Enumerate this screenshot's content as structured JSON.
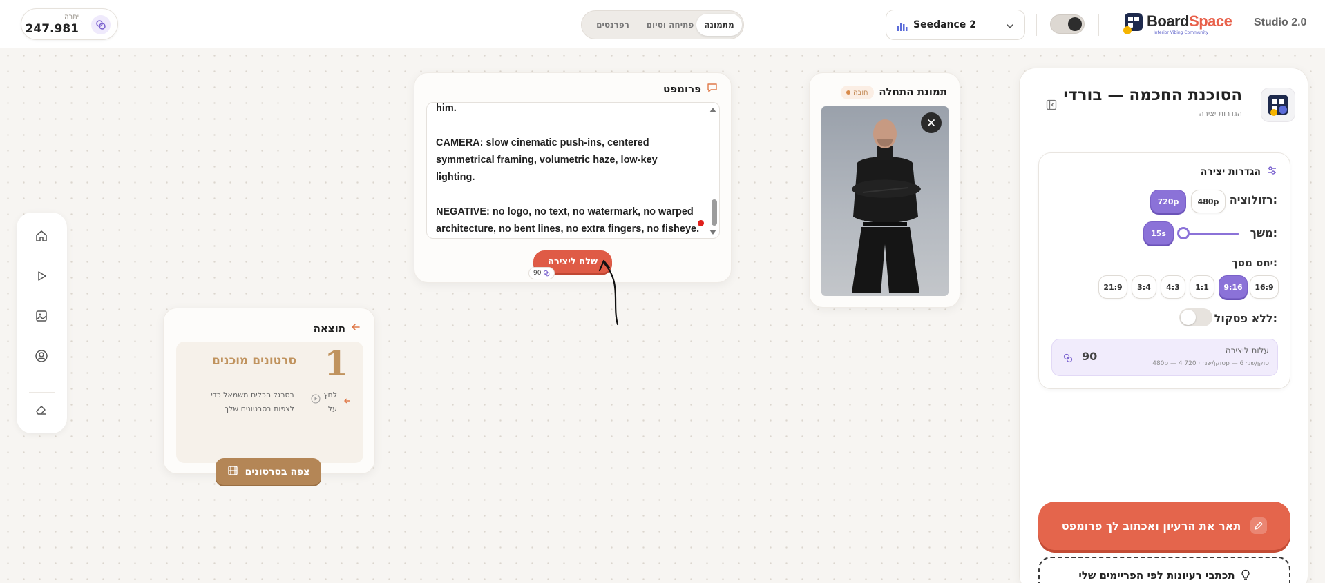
{
  "header": {
    "credits_label": "יתרה",
    "credits_value": "247.981",
    "modes": [
      {
        "label": "מתמונה",
        "active": true
      },
      {
        "label": "פתיחה וסיום",
        "active": false
      },
      {
        "label": "רפרנסים",
        "active": false
      }
    ],
    "model_name": "Seedance 2",
    "brand_name_main": "Board",
    "brand_name_accent": "Space",
    "brand_tagline": "Interior Vibing Community",
    "studio_label": "Studio 2.0"
  },
  "sidebar_tools": [
    "home-icon",
    "play-icon",
    "image-icon",
    "user-icon",
    "eraser-icon"
  ],
  "result_card": {
    "title": "תוצאה",
    "count": "1",
    "ready_label": "סרטונים מוכנים",
    "hint_text": "בסרגל הכלים משמאל כדי לצפות בסרטונים שלך",
    "click_text": "לחץ על",
    "watch_button": "צפה בסרטונים"
  },
  "prompt_card": {
    "title": "פרומפט",
    "text": "him.\n\nCAMERA: slow cinematic push-ins, centered\nsymmetrical framing, volumetric haze, low-key\nlighting.\n\nNEGATIVE: no logo, no text, no watermark, no warped\narchitecture, no bent lines, no extra fingers, no fisheye.",
    "send_button": "שלח ליצירה",
    "send_cost": "90"
  },
  "start_image_card": {
    "title": "תמונת התחלה",
    "required_badge": "חובה"
  },
  "right_panel": {
    "title": "הסוכנת החכמה — בורדי",
    "subtitle": "הגדרות יצירה",
    "settings_title": "הגדרות יצירה",
    "resolution_label": "רזולוציה:",
    "resolution_options": [
      {
        "label": "720p",
        "active": true
      },
      {
        "label": "480p",
        "active": false
      }
    ],
    "duration_label": "משך:",
    "duration_value": "15s",
    "duration_slider_fraction": 0.0,
    "aspect_label": "יחס מסך:",
    "aspect_options": [
      {
        "label": "16:9",
        "active": false
      },
      {
        "label": "9:16",
        "active": true
      },
      {
        "label": "1:1",
        "active": false
      },
      {
        "label": "4:3",
        "active": false
      },
      {
        "label": "3:4",
        "active": false
      },
      {
        "label": "21:9",
        "active": false
      }
    ],
    "no_punct_label": "ללא פסקול:",
    "no_punct_enabled": false,
    "cost_title": "עלות ליצירה",
    "cost_subtitle": "480p — 4 טוקן/שנ׳ · 720p — 6 טוקן/שנ׳",
    "cost_value": "90",
    "ai_button": "תאר את הרעיון ואכתוב לך פרומפט",
    "ideas_button": "תכתבי רעיונות לפי הפריימים שלי"
  },
  "colors": {
    "accent_red": "#df5b46",
    "accent_purple": "#8b72d8",
    "accent_brown": "#b48656"
  }
}
